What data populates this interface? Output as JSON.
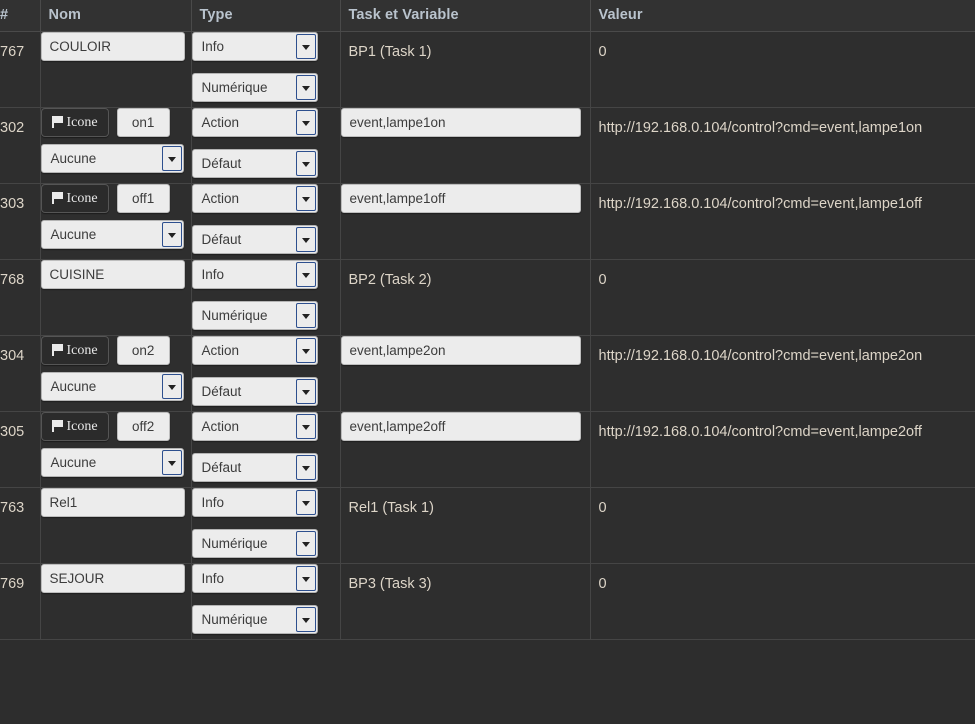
{
  "table": {
    "headers": {
      "id": "#",
      "nom": "Nom",
      "type": "Type",
      "task": "Task et Variable",
      "valeur": "Valeur"
    },
    "rows": [
      {
        "id": "767",
        "kind": "info",
        "nom_value": "COULOIR",
        "type_primary": "Info",
        "type_secondary": "Numérique",
        "task_text": "BP1 (Task 1)",
        "valeur": "0"
      },
      {
        "id": "302",
        "kind": "action",
        "icone_label": "Icone",
        "icone_glyph": "flag-icon",
        "nom_value": "on1",
        "icone_select": "Aucune",
        "type_primary": "Action",
        "type_secondary": "Défaut",
        "task_value": "event,lampe1on",
        "valeur": "http://192.168.0.104/control?cmd=event,lampe1on"
      },
      {
        "id": "303",
        "kind": "action",
        "icone_label": "Icone",
        "icone_glyph": "flag-icon",
        "nom_value": "off1",
        "icone_select": "Aucune",
        "type_primary": "Action",
        "type_secondary": "Défaut",
        "task_value": "event,lampe1off",
        "valeur": "http://192.168.0.104/control?cmd=event,lampe1off"
      },
      {
        "id": "768",
        "kind": "info",
        "nom_value": "CUISINE",
        "type_primary": "Info",
        "type_secondary": "Numérique",
        "task_text": "BP2 (Task 2)",
        "valeur": "0"
      },
      {
        "id": "304",
        "kind": "action",
        "icone_label": "Icone",
        "icone_glyph": "flag-icon",
        "nom_value": "on2",
        "icone_select": "Aucune",
        "type_primary": "Action",
        "type_secondary": "Défaut",
        "task_value": "event,lampe2on",
        "valeur": "http://192.168.0.104/control?cmd=event,lampe2on"
      },
      {
        "id": "305",
        "kind": "action",
        "icone_label": "Icone",
        "icone_glyph": "flag-icon",
        "nom_value": "off2",
        "icone_select": "Aucune",
        "type_primary": "Action",
        "type_secondary": "Défaut",
        "task_value": "event,lampe2off",
        "valeur": "http://192.168.0.104/control?cmd=event,lampe2off"
      },
      {
        "id": "763",
        "kind": "info",
        "nom_value": "Rel1",
        "type_primary": "Info",
        "type_secondary": "Numérique",
        "task_text": "Rel1 (Task 1)",
        "valeur": "0"
      },
      {
        "id": "769",
        "kind": "info",
        "nom_value": "SEJOUR",
        "type_primary": "Info",
        "type_secondary": "Numérique",
        "task_text": "BP3 (Task 3)",
        "valeur": "0"
      }
    ]
  },
  "colors": {
    "page_background": "#2d2d2d",
    "header_background": "#323232",
    "header_text": "#b9c3cd",
    "body_text": "#ddd5c8",
    "grid_line": "#454545",
    "control_background": "#ececec",
    "control_text": "#3c3c3c",
    "select_arrow_border": "#2d4f8e",
    "icone_button_background": "#2b2b2b"
  }
}
